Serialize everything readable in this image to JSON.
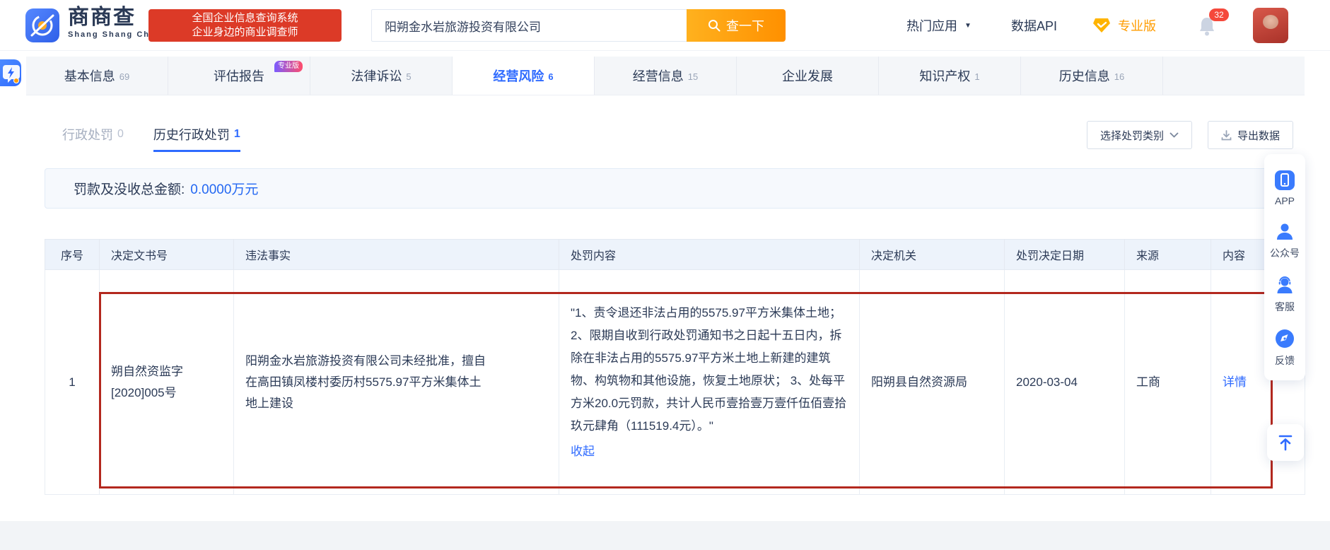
{
  "header": {
    "brand": {
      "name": "商商查",
      "sub": "Shang Shang Cha",
      "slogan_line1": "全国企业信息查询系统",
      "slogan_line2": "企业身边的商业调查师"
    },
    "search": {
      "value": "阳朔金水岩旅游投资有限公司",
      "button": "查一下"
    },
    "nav": {
      "hot_apps": "热门应用",
      "data_api": "数据API",
      "pro": "专业版",
      "notification_count": "32"
    }
  },
  "tabs": [
    {
      "label": "基本信息",
      "count": "69"
    },
    {
      "label": "评估报告",
      "badge": "专业版"
    },
    {
      "label": "法律诉讼",
      "count": "5"
    },
    {
      "label": "经营风险",
      "count": "6"
    },
    {
      "label": "经营信息",
      "count": "15"
    },
    {
      "label": "企业发展"
    },
    {
      "label": "知识产权",
      "count": "1"
    },
    {
      "label": "历史信息",
      "count": "16"
    }
  ],
  "subtabs": [
    {
      "label": "行政处罚",
      "count": "0"
    },
    {
      "label": "历史行政处罚",
      "count": "1"
    }
  ],
  "toolbar": {
    "filter": "选择处罚类别",
    "export": "导出数据"
  },
  "summary": {
    "label": "罚款及没收总金额:",
    "value": "0.0000万元"
  },
  "table": {
    "headers": [
      "序号",
      "决定文书号",
      "违法事实",
      "处罚内容",
      "决定机关",
      "处罚决定日期",
      "来源",
      "内容"
    ],
    "row": {
      "index": "1",
      "doc_no": "朔自然资监字[2020]005号",
      "fact": "阳朔金水岩旅游投资有限公司未经批准，擅自在高田镇凤楼村委历村5575.97平方米集体土地上建设",
      "penalty": "\"1、责令退还非法占用的5575.97平方米集体土地； 2、限期自收到行政处罚通知书之日起十五日内，拆除在非法占用的5575.97平方米土地上新建的建筑物、构筑物和其他设施，恢复土地原状； 3、处每平方米20.0元罚款，共计人民币壹拾壹万壹仟伍佰壹拾玖元肆角（111519.4元）。\"",
      "collapse": "收起",
      "authority": "阳朔县自然资源局",
      "date": "2020-03-04",
      "source": "工商",
      "detail": "详情"
    }
  },
  "sidebar": {
    "items": [
      {
        "label": "APP"
      },
      {
        "label": "公众号"
      },
      {
        "label": "客服"
      },
      {
        "label": "反馈"
      }
    ]
  },
  "colors": {
    "accent": "#2f6bff",
    "orange": "#ff9c00",
    "slogan_red": "#dc3a27",
    "highlight_red": "#b3281e",
    "summary_value": "#2468f2"
  }
}
